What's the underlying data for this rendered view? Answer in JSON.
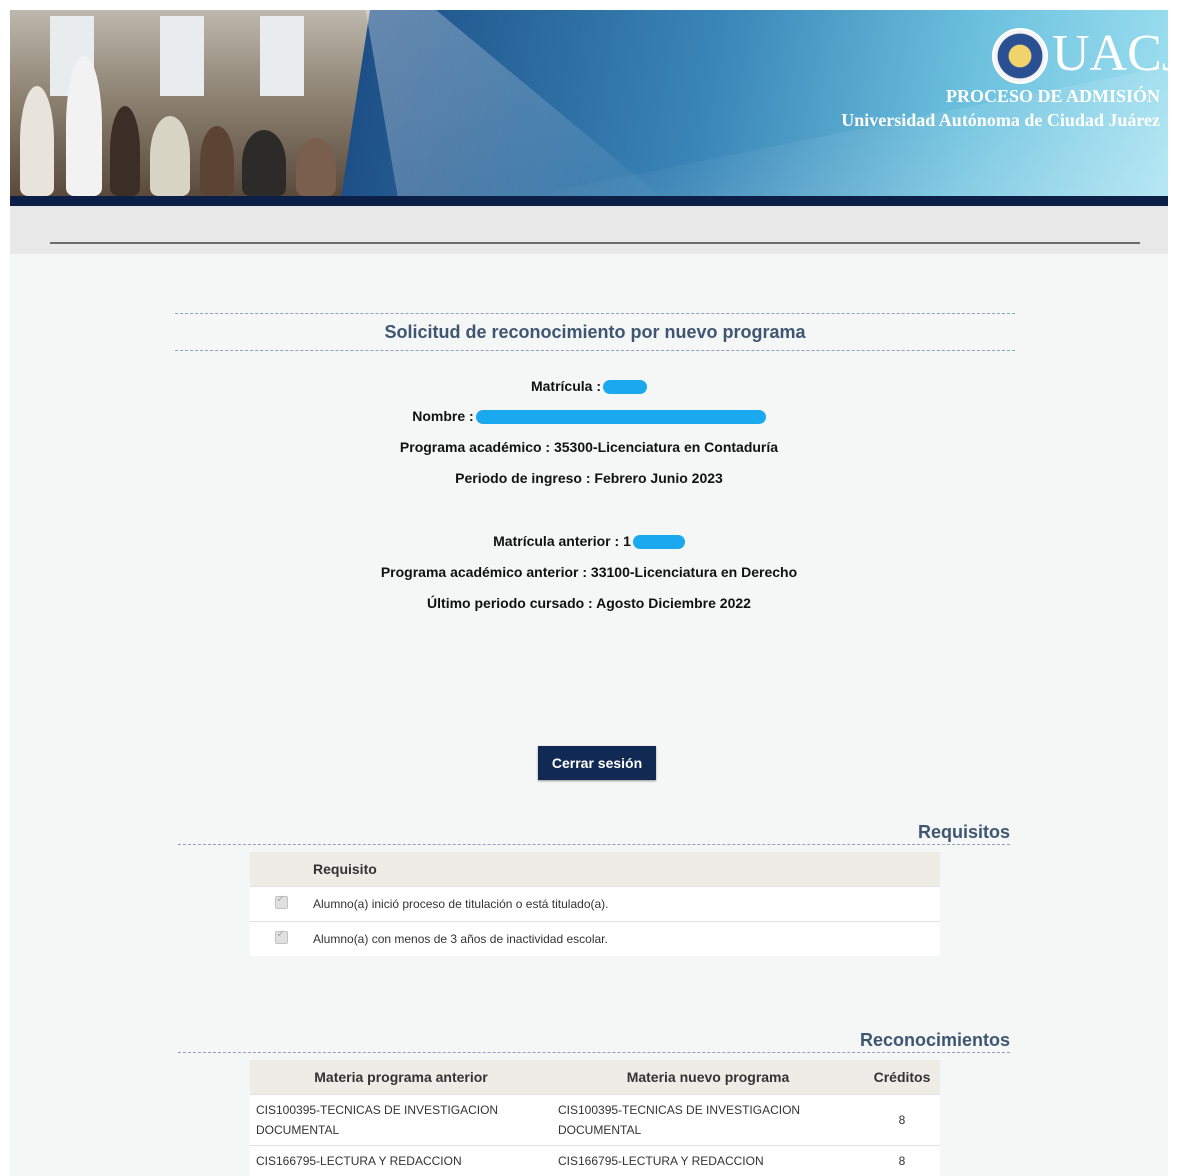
{
  "banner": {
    "logo": "UACJ",
    "line1": "PROCESO DE ADMISIÓN",
    "line2": "Universidad Autónoma de Ciudad Juárez"
  },
  "page": {
    "title": "Solicitud de reconocimiento por nuevo programa"
  },
  "info": {
    "matricula_label": "Matrícula :",
    "nombre_label": "Nombre :",
    "programa_label": "Programa académico :",
    "programa_value": "35300-Licenciatura en Contaduría",
    "periodo_label": "Periodo de ingreso :",
    "periodo_value": "Febrero Junio 2023",
    "matricula_anterior_label": "Matrícula anterior :",
    "matricula_anterior_prefix": "1",
    "programa_anterior_label": "Programa académico anterior :",
    "programa_anterior_value": "33100-Licenciatura en Derecho",
    "ultimo_periodo_label": "Último periodo cursado :",
    "ultimo_periodo_value": "Agosto Diciembre 2022"
  },
  "actions": {
    "close_session": "Cerrar sesión"
  },
  "requisitos": {
    "heading": "Requisitos",
    "column": "Requisito",
    "rows": [
      {
        "text": "Alumno(a) inició proceso de titulación o está titulado(a)."
      },
      {
        "text": "Alumno(a) con menos de 3 años de inactividad escolar."
      }
    ]
  },
  "reconocimientos": {
    "heading": "Reconocimientos",
    "columns": [
      "Materia programa anterior",
      "Materia nuevo programa",
      "Créditos"
    ],
    "rows": [
      {
        "anterior": "CIS100395-TECNICAS DE INVESTIGACION DOCUMENTAL",
        "nuevo": "CIS100395-TECNICAS DE INVESTIGACION DOCUMENTAL",
        "creditos": "8"
      },
      {
        "anterior": "CIS166795-LECTURA Y REDACCION",
        "nuevo": "CIS166795-LECTURA Y REDACCION",
        "creditos": "8"
      }
    ]
  },
  "colors": {
    "accent": "#102a54",
    "heading": "#3f5671",
    "redaction": "#1aa8ee"
  }
}
